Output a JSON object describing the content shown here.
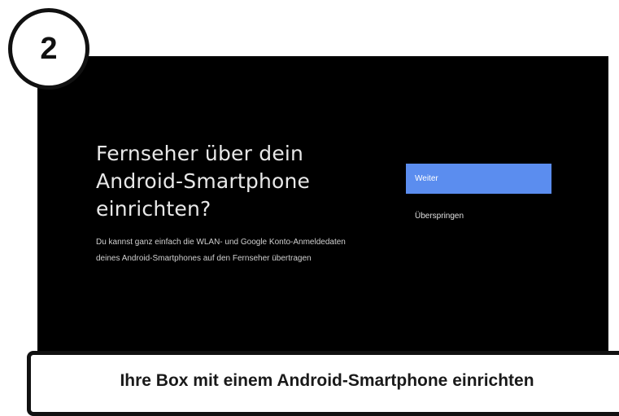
{
  "step": {
    "number": "2"
  },
  "screen": {
    "title": "Fernseher über dein Android-Smartphone einrichten?",
    "description_line1": "Du kannst ganz einfach die WLAN- und Google Konto-Anmeldedaten",
    "description_line2": "deines Android-Smartphones auf den Fernseher übertragen",
    "buttons": {
      "primary_label": "Weiter",
      "secondary_label": "Überspringen"
    }
  },
  "caption": {
    "text": "Ihre Box mit einem Android-Smartphone einrichten"
  },
  "colors": {
    "screen_background": "#000000",
    "primary_button": "#5b8def",
    "badge_border": "#111111"
  }
}
